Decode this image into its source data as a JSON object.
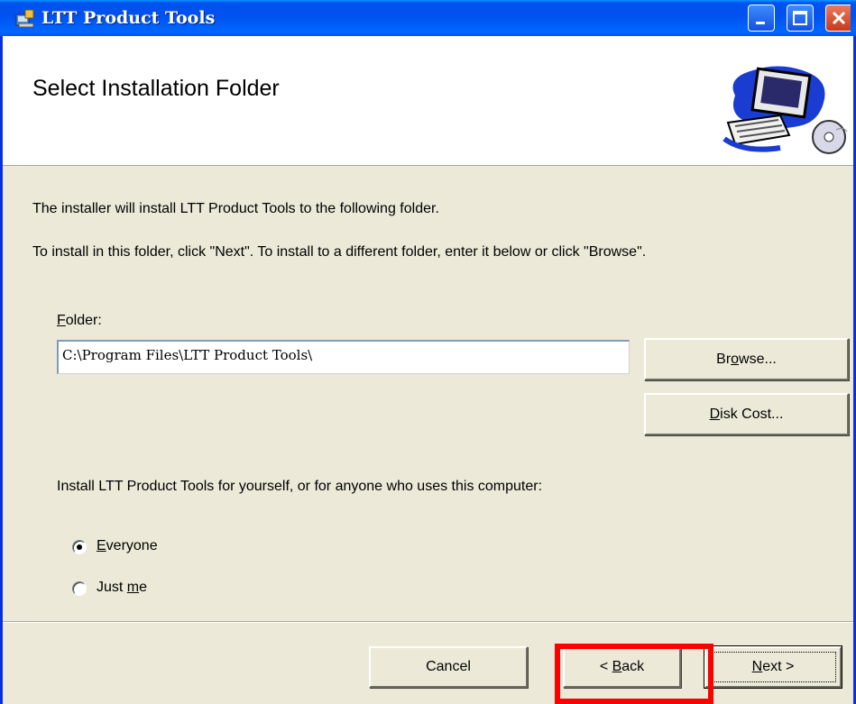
{
  "window": {
    "title": "LTT Product Tools",
    "icon": "installer-icon",
    "controls": [
      "minimize-icon",
      "maximize-icon",
      "close-icon"
    ]
  },
  "header": {
    "title": "Select Installation Folder",
    "art": "computer-with-cd-icon"
  },
  "body": {
    "intro": "The installer will install LTT Product Tools to the following folder.",
    "instruction": "To install in this folder, click \"Next\". To install to a different folder, enter it below or click \"Browse\"."
  },
  "folder": {
    "label_accel": "F",
    "label_rest": "older:",
    "value": "C:\\Program Files\\LTT Product Tools\\"
  },
  "buttons": {
    "browse": {
      "pre": "Br",
      "accel": "o",
      "post": "wse..."
    },
    "disk_cost": {
      "pre": "",
      "accel": "D",
      "post": "isk Cost..."
    },
    "cancel": "Cancel",
    "back": {
      "pre": "< ",
      "accel": "B",
      "post": "ack"
    },
    "next": {
      "pre": "",
      "accel": "N",
      "post": "ext >"
    }
  },
  "install_for": {
    "prompt": "Install LTT Product Tools for yourself, or for anyone who uses this computer:",
    "options": [
      {
        "pre": "",
        "accel": "E",
        "post": "veryone",
        "selected": true
      },
      {
        "pre": "Just ",
        "accel": "m",
        "post": "e",
        "selected": false
      }
    ]
  },
  "annotation": {
    "color": "#ff0000",
    "target": "back-button"
  }
}
